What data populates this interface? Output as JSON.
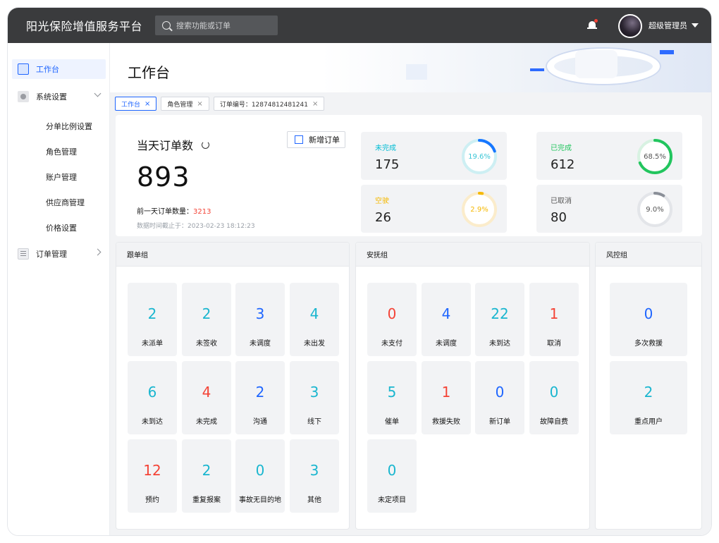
{
  "app": {
    "title": "阳光保险增值服务平台"
  },
  "search": {
    "placeholder": "搜索功能或订单"
  },
  "user": {
    "name": "超级管理员"
  },
  "sidebar": {
    "items": [
      {
        "label": "工作台"
      },
      {
        "label": "系统设置"
      },
      {
        "label": "订单管理"
      }
    ],
    "sub_items": [
      "分单比例设置",
      "角色管理",
      "账户管理",
      "供应商管理",
      "价格设置"
    ]
  },
  "page": {
    "title": "工作台"
  },
  "tabs": [
    {
      "label": "工作台"
    },
    {
      "label": "角色管理"
    },
    {
      "label": "订单编号：12874812481241"
    }
  ],
  "today": {
    "title": "当天订单数",
    "new_order_label": "新增订单",
    "count": "893",
    "prev_label": "前一天订单数量：",
    "prev_value": "3213",
    "stamp": "数据时间截止于：2023-02-23 18:12:23"
  },
  "stats": [
    {
      "label": "未完成",
      "value": "175",
      "percent_text": "19.6%",
      "percent": 19.6,
      "color": "#1677ff",
      "track": "#cdeff3",
      "text_color": "#3ac6d6",
      "label_color": "#00bcd4"
    },
    {
      "label": "已完成",
      "value": "612",
      "percent_text": "68.5%",
      "percent": 68.5,
      "color": "#22c55e",
      "track": "#d8f2e2",
      "text_color": "#555",
      "label_color": "#22c55e"
    },
    {
      "label": "空驶",
      "value": "26",
      "percent_text": "2.9%",
      "percent": 2.9,
      "color": "#f5b800",
      "track": "#fbeccb",
      "text_color": "#f5b800",
      "label_color": "#f5b800"
    },
    {
      "label": "已取消",
      "value": "80",
      "percent_text": "9.0%",
      "percent": 9.0,
      "color": "#8a8f98",
      "track": "#e3e5e9",
      "text_color": "#555",
      "label_color": "#555"
    }
  ],
  "groups": [
    {
      "title": "跟单组",
      "cells": [
        {
          "num": "2",
          "label": "未派单",
          "color": "#1ab6cf"
        },
        {
          "num": "2",
          "label": "未签收",
          "color": "#1ab6cf"
        },
        {
          "num": "3",
          "label": "未调度",
          "color": "#1f66ff"
        },
        {
          "num": "4",
          "label": "未出发",
          "color": "#1ab6cf"
        },
        {
          "num": "6",
          "label": "未到达",
          "color": "#1ab6cf"
        },
        {
          "num": "4",
          "label": "未完成",
          "color": "#f44336"
        },
        {
          "num": "2",
          "label": "沟通",
          "color": "#1f66ff"
        },
        {
          "num": "3",
          "label": "线下",
          "color": "#1ab6cf"
        },
        {
          "num": "12",
          "label": "预约",
          "color": "#f44336"
        },
        {
          "num": "2",
          "label": "重复报案",
          "color": "#1ab6cf"
        },
        {
          "num": "0",
          "label": "事故无目的地",
          "color": "#1ab6cf"
        },
        {
          "num": "3",
          "label": "其他",
          "color": "#1ab6cf"
        }
      ]
    },
    {
      "title": "安抚组",
      "cells": [
        {
          "num": "0",
          "label": "未支付",
          "color": "#f44336"
        },
        {
          "num": "4",
          "label": "未调度",
          "color": "#1f66ff"
        },
        {
          "num": "22",
          "label": "未到达",
          "color": "#1ab6cf"
        },
        {
          "num": "1",
          "label": "取消",
          "color": "#f44336"
        },
        {
          "num": "5",
          "label": "催单",
          "color": "#1ab6cf"
        },
        {
          "num": "1",
          "label": "救援失败",
          "color": "#f44336"
        },
        {
          "num": "0",
          "label": "新订单",
          "color": "#1f66ff"
        },
        {
          "num": "0",
          "label": "故障自费",
          "color": "#1ab6cf"
        },
        {
          "num": "0",
          "label": "未定项目",
          "color": "#1ab6cf"
        }
      ]
    },
    {
      "title": "风控组",
      "cells": [
        {
          "num": "0",
          "label": "多次救援",
          "color": "#1f66ff"
        },
        {
          "num": "2",
          "label": "重点用户",
          "color": "#1ab6cf"
        }
      ]
    }
  ]
}
